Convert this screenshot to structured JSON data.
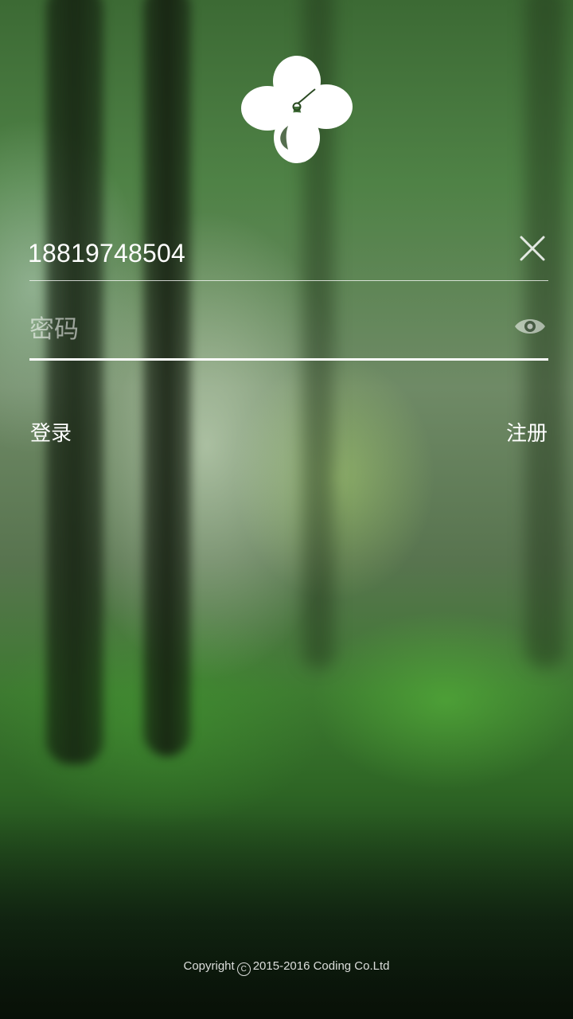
{
  "login": {
    "phone_value": "18819748504",
    "password_placeholder": "密码",
    "login_label": "登录",
    "register_label": "注册"
  },
  "icons": {
    "logo": "clover-icon",
    "clear": "close-icon",
    "visibility": "eye-icon"
  },
  "footer": {
    "copyright_prefix": "Copyright",
    "copyright_symbol": "C",
    "copyright_text": "2015-2016 Coding Co.Ltd"
  }
}
